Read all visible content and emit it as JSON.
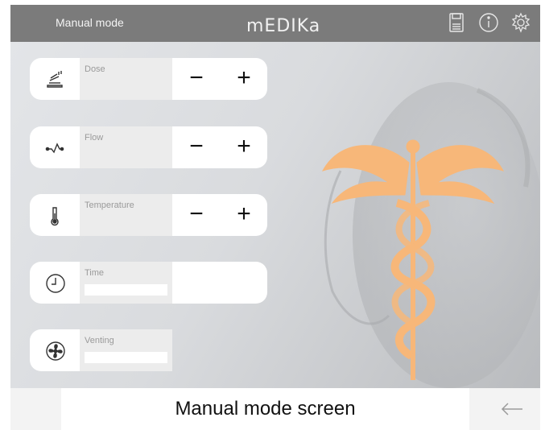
{
  "header": {
    "title": "Manual mode",
    "brand": "mEDIKa"
  },
  "controls": [
    {
      "name": "dose",
      "label": "Dose",
      "icon": "dose-icon",
      "minus": "−",
      "plus": "+"
    },
    {
      "name": "flow",
      "label": "Flow",
      "icon": "flow-icon",
      "minus": "−",
      "plus": "+"
    },
    {
      "name": "temperature",
      "label": "Temperature",
      "icon": "thermometer-icon",
      "minus": "−",
      "plus": "+"
    },
    {
      "name": "time",
      "label": "Time",
      "icon": "clock-icon"
    },
    {
      "name": "venting",
      "label": "Venting",
      "icon": "fan-icon"
    }
  ],
  "footer": {
    "caption": "Manual mode screen"
  },
  "colors": {
    "topbar": "#7b7b7b",
    "caduceus": "#f7b779"
  }
}
